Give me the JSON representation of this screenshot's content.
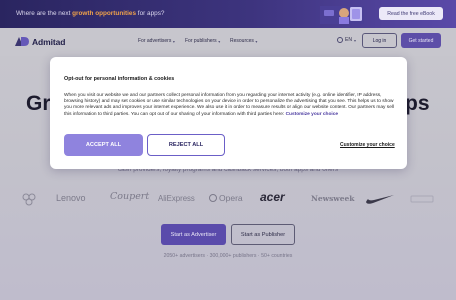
{
  "promo": {
    "text_before": "Where are the next ",
    "highlight": "growth opportunities",
    "text_after": " for apps?",
    "button": "Read the free eBook"
  },
  "nav": {
    "logo": "Admitad",
    "items": [
      "For advertisers",
      "For publishers",
      "Resources"
    ],
    "lang": "EN",
    "login": "Log in",
    "get_started": "Get started"
  },
  "hero": {
    "heading_left": "Gr",
    "heading_right": "ps",
    "subtitle": "cash providers, loyalty programs and cashback services, both apps and offers",
    "brands": [
      "Lenovo",
      "Coupert",
      "AliExpress",
      "Opera",
      "acer",
      "Newsweek"
    ],
    "cta_advertiser": "Start as Advertiser",
    "cta_publisher": "Start as Publisher",
    "stats": "2050+ advertisers · 300,000+ publishers · 50+ countries"
  },
  "cookie": {
    "title": "Opt-out for personal information & cookies",
    "body": "When you visit our website we and our partners collect personal information from you regarding your internet activity (e.g. online identifier, IP address, browsing history) and may set cookies or use similar technologies on your device in order to personalize the advertising that you see. This helps us to show you more relevant ads and improves your internet experience. We also use it in order to measure results or align our website content. Our partners may sell this information to third parties. You can opt out of our sharing of your information with third parties here: ",
    "body_link": "Customize your choice",
    "accept": "ACCEPT ALL",
    "reject": "REJECT ALL",
    "customize": "Customize your choice"
  },
  "colors": {
    "accent": "#5d4ea8",
    "accept_button": "#8f83de",
    "promo_highlight": "#f0a24a"
  }
}
